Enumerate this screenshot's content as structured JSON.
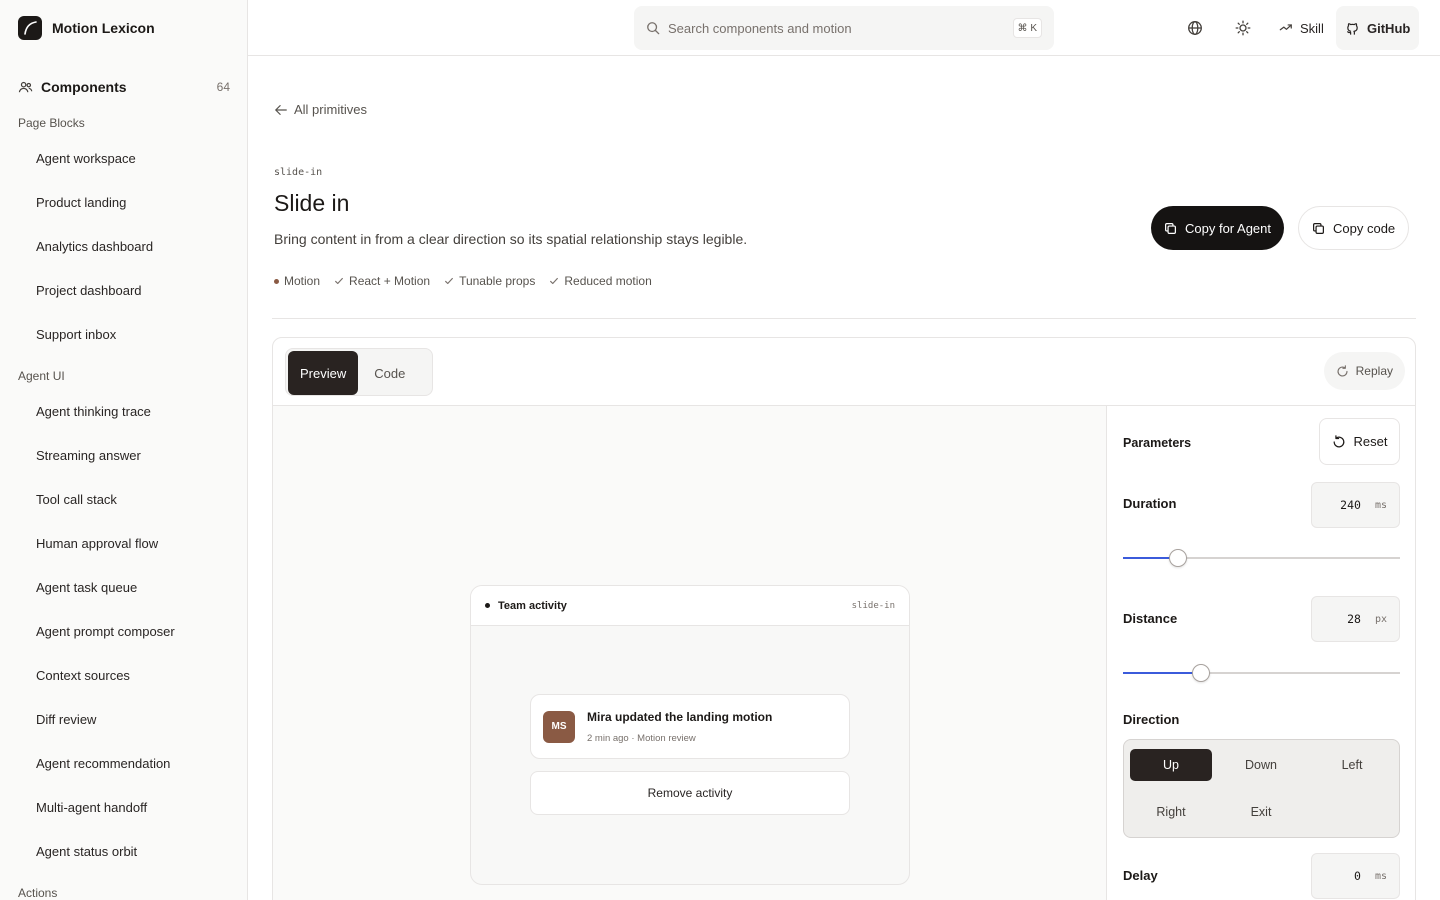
{
  "app": {
    "name": "Motion Lexicon"
  },
  "sidebar": {
    "components_label": "Components",
    "components_count": "64",
    "sections": [
      {
        "title": "Page Blocks",
        "items": [
          "Agent workspace",
          "Product landing",
          "Analytics dashboard",
          "Project dashboard",
          "Support inbox"
        ]
      },
      {
        "title": "Agent UI",
        "items": [
          "Agent thinking trace",
          "Streaming answer",
          "Tool call stack",
          "Human approval flow",
          "Agent task queue",
          "Agent prompt composer",
          "Context sources",
          "Diff review",
          "Agent recommendation",
          "Multi-agent handoff",
          "Agent status orbit"
        ]
      },
      {
        "title": "Actions",
        "items": []
      }
    ]
  },
  "header": {
    "search_placeholder": "Search components and motion",
    "shortcut": "⌘ K",
    "skill_label": "Skill",
    "github_label": "GitHub"
  },
  "page": {
    "back_label": "All primitives",
    "slug": "slide-in",
    "title": "Slide in",
    "description": "Bring content in from a clear direction so its spatial relationship stays legible.",
    "tags": [
      "Motion",
      "React + Motion",
      "Tunable props",
      "Reduced motion"
    ],
    "copy_agent_label": "Copy for Agent",
    "copy_code_label": "Copy code"
  },
  "panel": {
    "tabs": [
      "Preview",
      "Code"
    ],
    "active_tab": "Preview",
    "replay_label": "Replay"
  },
  "demo": {
    "title": "Team activity",
    "slug": "slide-in",
    "avatar_initials": "MS",
    "activity_title": "Mira updated the landing motion",
    "activity_meta": "2 min ago · Motion review",
    "remove_label": "Remove activity"
  },
  "params": {
    "title": "Parameters",
    "reset_label": "Reset",
    "duration": {
      "label": "Duration",
      "value": "240",
      "unit": "ms",
      "slider_fraction": 0.2
    },
    "distance": {
      "label": "Distance",
      "value": "28",
      "unit": "px",
      "slider_fraction": 0.28
    },
    "direction": {
      "label": "Direction",
      "options": [
        "Up",
        "Down",
        "Left",
        "Right",
        "Exit"
      ],
      "selected": "Up"
    },
    "delay": {
      "label": "Delay",
      "value": "0",
      "unit": "ms"
    }
  },
  "colors": {
    "accent": "#3b5bdb",
    "dark": "#151312",
    "avatar": "#8a5a44",
    "sidebar_bg": "#fafaf9"
  }
}
